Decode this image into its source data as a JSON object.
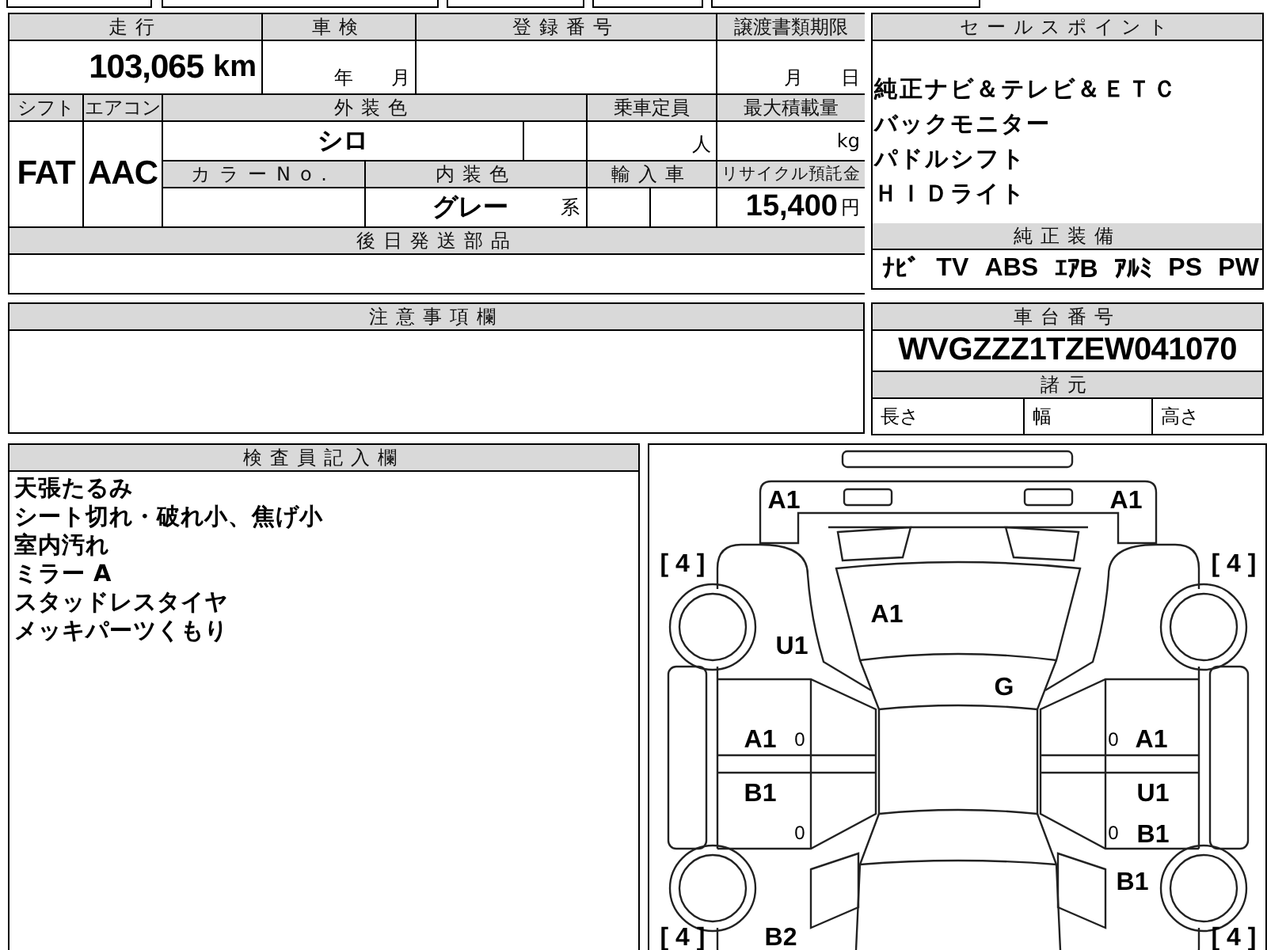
{
  "vehicle_table": {
    "mileage": {
      "label": "走行",
      "value": "103,065",
      "unit": "km"
    },
    "inspection": {
      "label": "車検",
      "year_unit": "年",
      "month_unit": "月"
    },
    "registration_number": {
      "label": "登録番号"
    },
    "transfer_document_deadline": {
      "label": "譲渡書類期限",
      "month_unit": "月",
      "day_unit": "日"
    },
    "shift": {
      "label": "シフト",
      "value": "FAT"
    },
    "air_conditioner": {
      "label": "エアコン",
      "value": "AAC"
    },
    "exterior_color": {
      "label": "外装色",
      "value": "シロ"
    },
    "capacity": {
      "label": "乗車定員",
      "unit": "人"
    },
    "max_load": {
      "label": "最大積載量",
      "unit": "kg"
    },
    "color_number": {
      "label": "カラーNo."
    },
    "interior_color": {
      "label": "内装色",
      "value": "グレー",
      "suffix": "系"
    },
    "imported": {
      "label": "輸入車"
    },
    "recycling_fee": {
      "label": "リサイクル預託金",
      "value": "15,400",
      "unit": "円"
    },
    "parts_sent_later": {
      "label": "後日発送部品"
    }
  },
  "sale_points": {
    "label": "セールスポイント",
    "items": [
      "純正ナビ＆テレビ＆ＥＴＣ",
      "バックモニター",
      "パドルシフト",
      "ＨＩＤライト"
    ]
  },
  "standard_equipment": {
    "label": "純正装備",
    "items": [
      "ﾅﾋﾞ",
      "TV",
      "ABS",
      "ｴｱB",
      "ｱﾙﾐ",
      "PS",
      "PW"
    ]
  },
  "notes": {
    "label": "注意事項欄"
  },
  "chassis_number": {
    "label": "車台番号",
    "value": "WVGZZZ1TZEW041070"
  },
  "specifications": {
    "label": "諸元",
    "items": [
      "長さ",
      "幅",
      "高さ"
    ]
  },
  "inspector_notes": {
    "label": "検査員記入欄",
    "lines": [
      "天張たるみ",
      "シート切れ・破れ小、焦げ小",
      "室内汚れ",
      "ミラー A",
      "スタッドレスタイヤ",
      "メッキパーツくもり"
    ]
  },
  "damage_diagram": {
    "marks": {
      "front_bumper_left": "A1",
      "front_bumper_right": "A1",
      "hood": "A1",
      "front_left_fender": "U1",
      "windshield": "G",
      "front_left_door": "A1",
      "rear_left_door": "B1",
      "front_right_door": "A1",
      "rear_right_door": "U1",
      "rear_right_door_lower": "B1",
      "rear_right_fender": "B1",
      "rear_left_fender": "B2"
    },
    "door_marks": {
      "front_left_door": "0",
      "rear_left_door": "0",
      "front_right_door": "0",
      "rear_right_door": "0"
    },
    "tread_depth": {
      "front_left": "[ 4 ]",
      "front_right": "[ 4 ]",
      "rear_left": "[ 4 ]",
      "rear_right": "[ 4 ]"
    }
  }
}
